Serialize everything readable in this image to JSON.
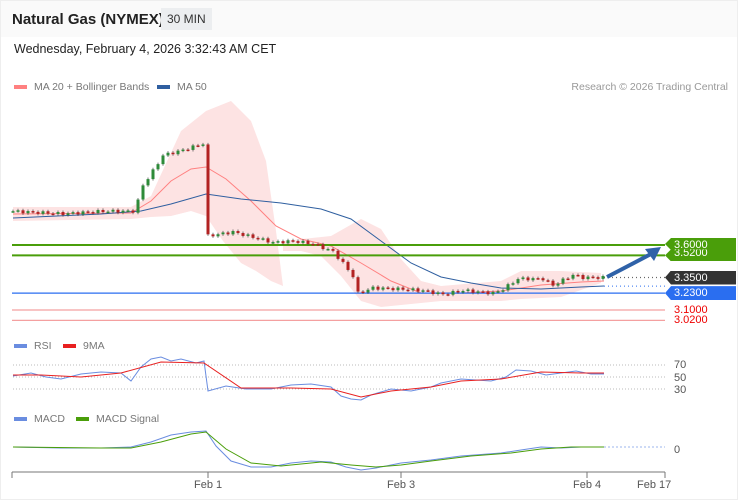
{
  "header": {
    "title": "Natural Gas (NYMEX)",
    "timeframe": "30 MIN",
    "datetime": "Wednesday, February 4, 2026 3:32:43 AM CET"
  },
  "legend": {
    "ma20": "MA 20 + Bollinger Bands",
    "ma50": "MA 50",
    "rsi": "RSI",
    "rsi_ma": "9MA",
    "macd": "MACD",
    "macd_signal": "MACD Signal"
  },
  "credit": "Research © 2026 Trading Central",
  "levels": [
    {
      "label": "3.6000",
      "price": 3.6,
      "type": "resistance",
      "color": "#4a9e0a"
    },
    {
      "label": "3.5200",
      "price": 3.52,
      "type": "resistance",
      "color": "#4a9e0a"
    },
    {
      "label": "3.3500",
      "price": 3.35,
      "type": "last",
      "color": "#333333"
    },
    {
      "label": "3.2300",
      "price": 3.23,
      "type": "pivot",
      "color": "#2a6ef0"
    },
    {
      "label": "3.1000",
      "price": 3.1,
      "type": "support",
      "color": "#e82020"
    },
    {
      "label": "3.0200",
      "price": 3.02,
      "type": "support",
      "color": "#e82020"
    }
  ],
  "rsi_axis": [
    "70",
    "50",
    "30"
  ],
  "macd_axis": [
    "0"
  ],
  "x_axis": [
    "Feb 1",
    "Feb 3",
    "Feb 4",
    "Feb 17"
  ],
  "chart_data": {
    "type": "candlestick",
    "approx_price_path": [
      [
        0,
        3.86
      ],
      [
        10,
        3.84
      ],
      [
        18,
        3.86
      ],
      [
        24,
        3.86
      ],
      [
        25,
        3.94
      ],
      [
        26,
        4.06
      ],
      [
        28,
        4.17
      ],
      [
        30,
        4.29
      ],
      [
        34,
        4.33
      ],
      [
        38,
        4.38
      ],
      [
        39,
        3.67
      ],
      [
        44,
        3.7
      ],
      [
        48,
        3.66
      ],
      [
        52,
        3.62
      ],
      [
        56,
        3.63
      ],
      [
        60,
        3.61
      ],
      [
        64,
        3.55
      ],
      [
        66,
        3.46
      ],
      [
        68,
        3.36
      ],
      [
        69,
        3.23
      ],
      [
        72,
        3.27
      ],
      [
        78,
        3.26
      ],
      [
        82,
        3.25
      ],
      [
        86,
        3.22
      ],
      [
        90,
        3.25
      ],
      [
        96,
        3.23
      ],
      [
        98,
        3.26
      ],
      [
        101,
        3.34
      ],
      [
        106,
        3.34
      ],
      [
        108,
        3.29
      ],
      [
        112,
        3.37
      ],
      [
        114,
        3.35
      ],
      [
        118,
        3.35
      ]
    ]
  }
}
